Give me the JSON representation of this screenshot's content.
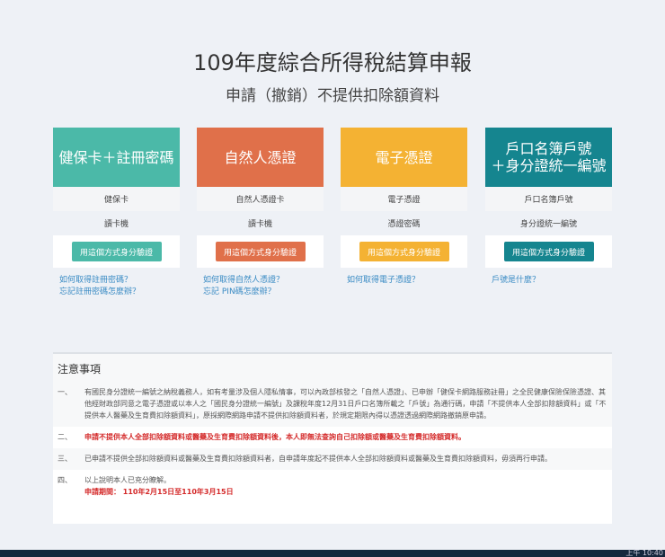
{
  "title": "109年度綜合所得稅結算申報",
  "subtitle": "申請（撤銷）不提供扣除額資料",
  "cards": [
    {
      "head": "健保卡＋註冊密碼",
      "r1": "健保卡",
      "r2": "讀卡機",
      "button": "用這個方式身分驗證",
      "links": [
        "如何取得註冊密碼？",
        "忘記註冊密碼怎麼辦？"
      ],
      "color": "#4bb9a8"
    },
    {
      "head": "自然人憑證",
      "r1": "自然人憑證卡",
      "r2": "讀卡機",
      "button": "用這個方式身分驗證",
      "links": [
        "如何取得自然人憑證？",
        "忘記 PIN碼怎麼辦？"
      ],
      "color": "#e0704a"
    },
    {
      "head": "電子憑證",
      "r1": "電子憑證",
      "r2": "憑證密碼",
      "button": "用這個方式身分驗證",
      "links": [
        "如何取得電子憑證？"
      ],
      "color": "#f4b233"
    },
    {
      "head": "戶口名簿戶號\n＋身分證統一編號",
      "r1": "戶口名簿戶號",
      "r2": "身分證統一編號",
      "button": "用這個方式身分驗證",
      "links": [
        "戶號是什麼？"
      ],
      "color": "#15858f"
    }
  ],
  "notice": {
    "title": "注意事項",
    "items": [
      {
        "num": "一、",
        "text": "有國民身分證統一編號之納稅義務人，如有考量涉及個人隱私情事，可以內政部核發之「自然人憑證」、已申辦「健保卡網路服務註冊」之全民健康保險保險憑證、其他經財政部同意之電子憑證或以本人之「國民身分證統一編號」及課稅年度12月31日戶口名簿所載之「戶號」為通行碼，申請「不提供本人全部扣除額資料」或「不提供本人醫藥及生育費扣除額資料」，原採網際網路申請不提供扣除額資料者，於規定期限內得以憑證透過網際網路撤銷原申請。"
      },
      {
        "num": "二、",
        "text": "申請不提供本人全部扣除額資料或醫藥及生育費扣除額資料後，本人即無法查詢自己扣除額或醫藥及生育費扣除額資料。"
      },
      {
        "num": "三、",
        "text": "已申請不提供全部扣除額資料或醫藥及生育費扣除額資料者，自申請年度起不提供本人全部扣除額資料或醫藥及生育費扣除額資料，毋須再行申請。"
      },
      {
        "num": "四、",
        "text": "以上說明本人已充分瞭解。",
        "period": "申請期間： 110年2月15日至110年3月15日"
      }
    ]
  },
  "clock": "上午 10:40"
}
